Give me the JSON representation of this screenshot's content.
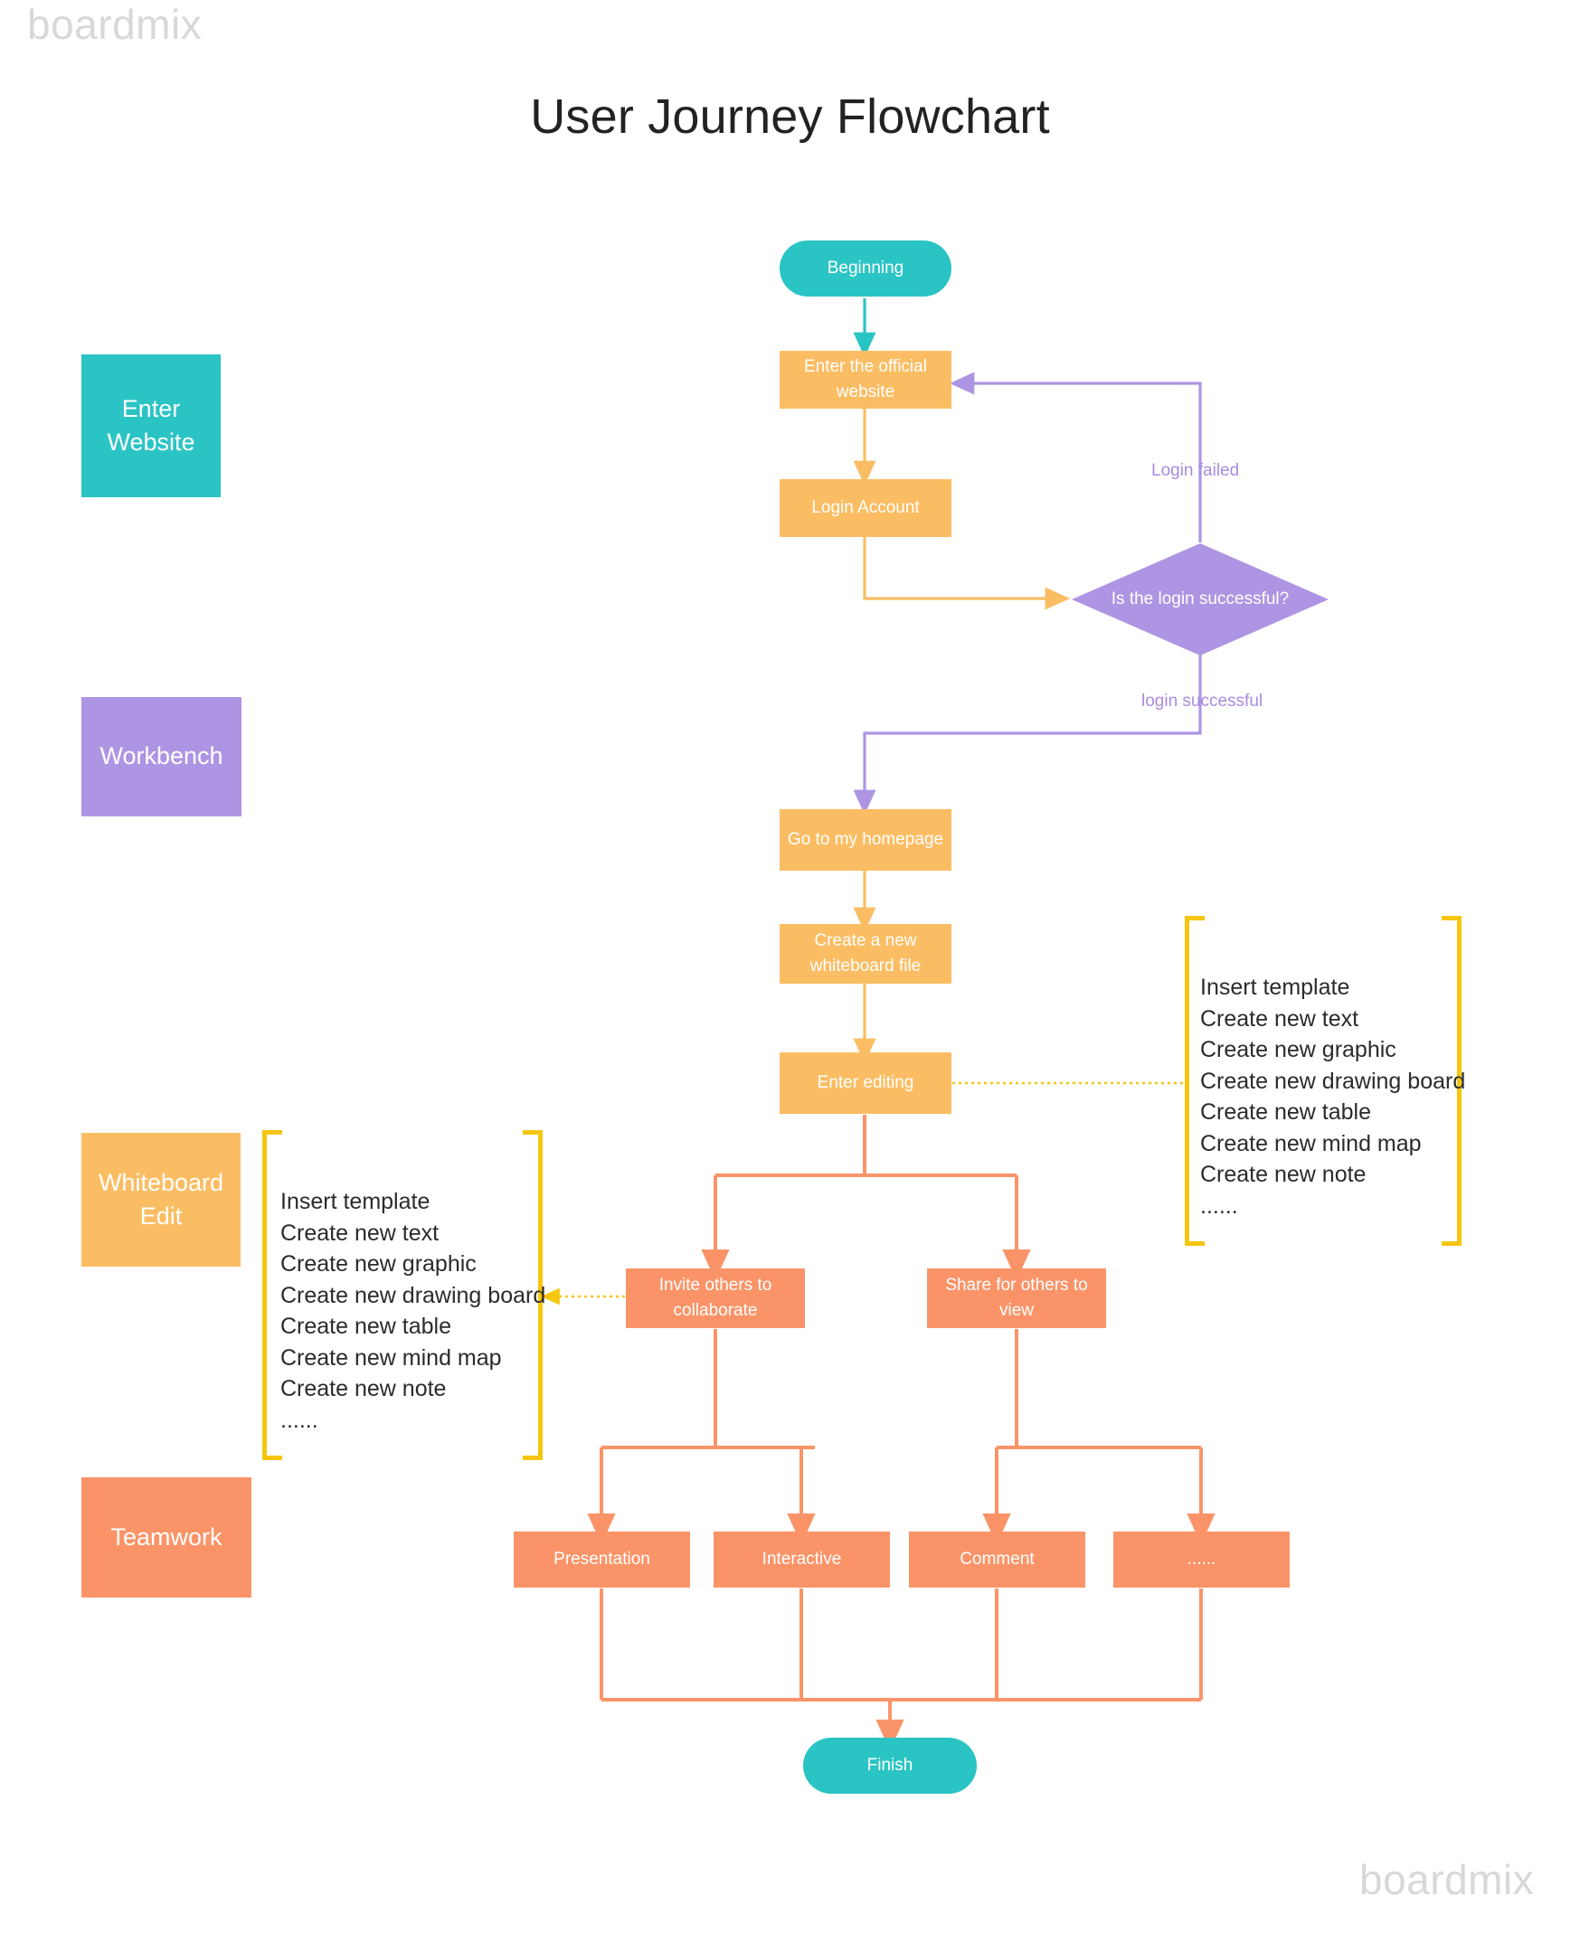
{
  "watermark": {
    "top": "boardmix",
    "bottom": "boardmix"
  },
  "title": "User Journey Flowchart",
  "colors": {
    "teal": "#2BC4C4",
    "orange": "#FBBD63",
    "purple": "#AE95E3",
    "salmon": "#FA9468",
    "yellow_bracket": "#F6C60E",
    "title_text": "#222222",
    "watermark_text": "#D6D8DA"
  },
  "legend": {
    "items": [
      {
        "label": "Enter Website",
        "color": "#2BC4C4"
      },
      {
        "label": "Workbench",
        "color": "#AE95E3"
      },
      {
        "label": "Whiteboard Edit",
        "color": "#FBBD63"
      },
      {
        "label": "Teamwork",
        "color": "#FA9468"
      }
    ]
  },
  "nodes": {
    "beginning": "Beginning",
    "enter_website": "Enter the official website",
    "login_account": "Login Account",
    "decision": "Is the login successful?",
    "homepage": "Go to my homepage",
    "create_file": "Create a new whiteboard file",
    "enter_editing": "Enter editing",
    "invite": "Invite others to collaborate",
    "share": "Share for others to view",
    "presentation": "Presentation",
    "interactive": "Interactive",
    "comment": "Comment",
    "more": "......",
    "finish": "Finish"
  },
  "edge_labels": {
    "login_failed": "Login failed",
    "login_successful": "login successful"
  },
  "bracket_list": {
    "items": [
      "Insert template",
      "Create new text",
      "Create new graphic",
      "Create new drawing board",
      "Create new table",
      "Create new mind map",
      "Create new note",
      "......"
    ]
  },
  "chart_data": {
    "type": "diagram",
    "title": "User Journey Flowchart",
    "phases": [
      "Enter Website",
      "Workbench",
      "Whiteboard Edit",
      "Teamwork"
    ],
    "steps": [
      "Beginning",
      "Enter the official website",
      "Login Account",
      "Is the login successful?",
      "Go to my homepage",
      "Create a new whiteboard file",
      "Enter editing",
      "Invite others to collaborate",
      "Share for others to view",
      "Presentation",
      "Interactive",
      "Comment",
      "......",
      "Finish"
    ],
    "edges": [
      {
        "from": "Beginning",
        "to": "Enter the official website",
        "label": ""
      },
      {
        "from": "Enter the official website",
        "to": "Login Account",
        "label": ""
      },
      {
        "from": "Login Account",
        "to": "Is the login successful?",
        "label": ""
      },
      {
        "from": "Is the login successful?",
        "to": "Enter the official website",
        "label": "Login failed"
      },
      {
        "from": "Is the login successful?",
        "to": "Go to my homepage",
        "label": "login successful"
      },
      {
        "from": "Go to my homepage",
        "to": "Create a new whiteboard file",
        "label": ""
      },
      {
        "from": "Create a new whiteboard file",
        "to": "Enter editing",
        "label": ""
      },
      {
        "from": "Enter editing",
        "to": "Invite others to collaborate",
        "label": ""
      },
      {
        "from": "Enter editing",
        "to": "Share for others to view",
        "label": ""
      },
      {
        "from": "Invite others to collaborate",
        "to": "Presentation",
        "label": ""
      },
      {
        "from": "Invite others to collaborate",
        "to": "Interactive",
        "label": ""
      },
      {
        "from": "Share for others to view",
        "to": "Comment",
        "label": ""
      },
      {
        "from": "Share for others to view",
        "to": "......",
        "label": ""
      },
      {
        "from": "Presentation",
        "to": "Finish",
        "label": ""
      },
      {
        "from": "Interactive",
        "to": "Finish",
        "label": ""
      },
      {
        "from": "Comment",
        "to": "Finish",
        "label": ""
      },
      {
        "from": "......",
        "to": "Finish",
        "label": ""
      }
    ]
  }
}
